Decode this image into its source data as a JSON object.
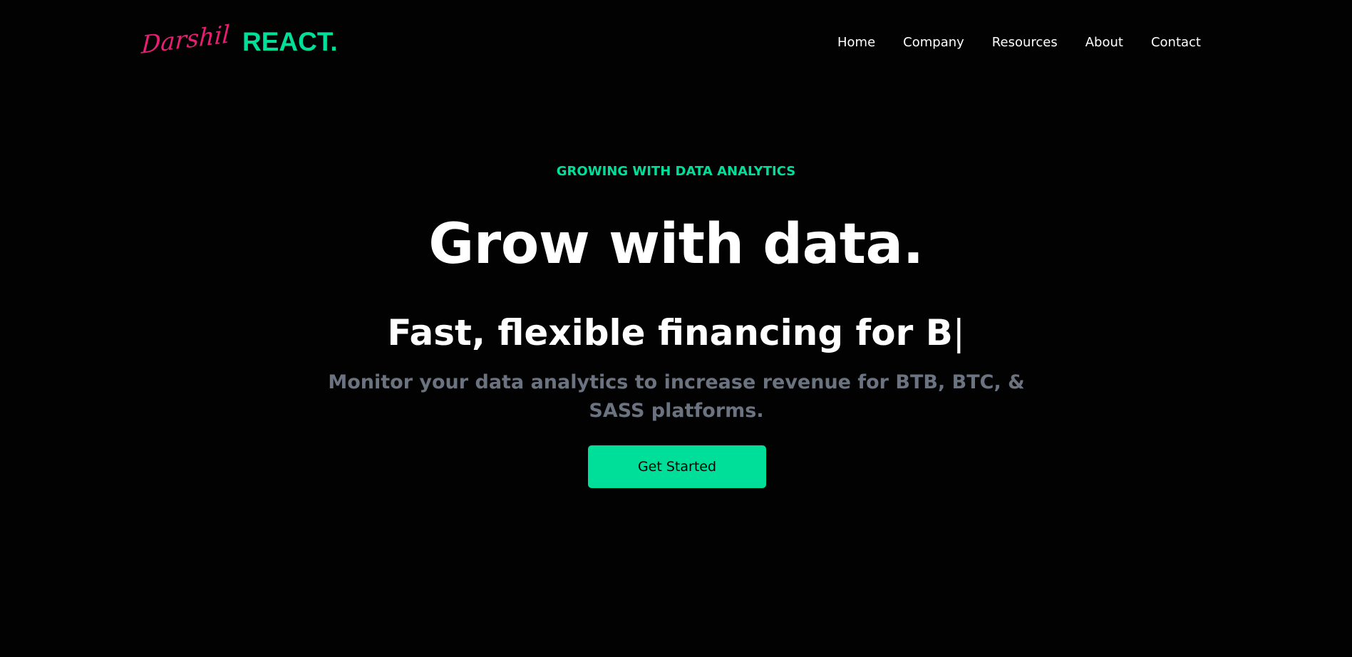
{
  "brand": {
    "signature": "Darshil",
    "name": "REACT."
  },
  "nav": {
    "items": [
      {
        "label": "Home"
      },
      {
        "label": "Company"
      },
      {
        "label": "Resources"
      },
      {
        "label": "About"
      },
      {
        "label": "Contact"
      }
    ]
  },
  "hero": {
    "eyebrow": "GROWING WITH DATA ANALYTICS",
    "title": "Grow with data.",
    "typed_prefix": "Fast, flexible financing for",
    "typed_text": "B",
    "cursor": "|",
    "subtitle": "Monitor your data analytics to increase revenue for BTB, BTC, & SASS platforms.",
    "cta_label": "Get Started"
  },
  "colors": {
    "background": "#020202",
    "accent": "#00df9a",
    "signature": "#e91e73",
    "subtitle": "#6b7280",
    "text": "#ffffff"
  }
}
